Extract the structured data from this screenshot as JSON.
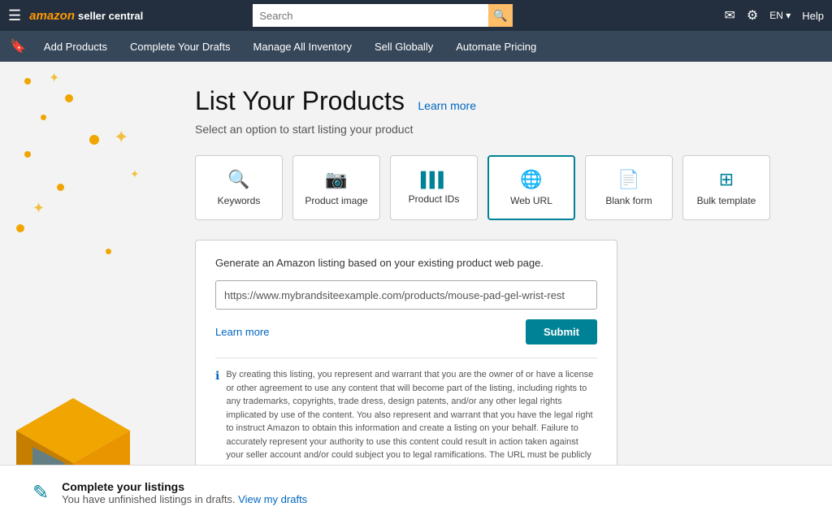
{
  "topbar": {
    "hamburger": "☰",
    "logo_amazon": "amazon",
    "logo_text": "seller central",
    "search_placeholder": "Search",
    "search_icon": "🔍",
    "mail_icon": "✉",
    "settings_icon": "⚙",
    "language": "EN ▾",
    "help": "Help"
  },
  "navbar": {
    "bookmark_icon": "🔖",
    "items": [
      {
        "label": "Add Products",
        "id": "add-products"
      },
      {
        "label": "Complete Your Drafts",
        "id": "complete-drafts"
      },
      {
        "label": "Manage All Inventory",
        "id": "manage-inventory"
      },
      {
        "label": "Sell Globally",
        "id": "sell-globally"
      },
      {
        "label": "Automate Pricing",
        "id": "automate-pricing"
      }
    ]
  },
  "page": {
    "title": "List Your Products",
    "learn_more": "Learn more",
    "subtitle": "Select an option to start listing your product"
  },
  "options": [
    {
      "id": "keywords",
      "icon": "🔍",
      "label": "Keywords"
    },
    {
      "id": "product-image",
      "icon": "📷",
      "label": "Product image"
    },
    {
      "id": "product-ids",
      "icon": "▌▌▌",
      "label": "Product IDs"
    },
    {
      "id": "web-url",
      "icon": "🌐",
      "label": "Web URL",
      "active": true
    },
    {
      "id": "blank-form",
      "icon": "📄",
      "label": "Blank form"
    },
    {
      "id": "bulk-template",
      "icon": "⊞",
      "label": "Bulk template"
    }
  ],
  "form": {
    "description": "Generate an Amazon listing based on your existing product web page.",
    "url_placeholder": "https://www.mybrandsiteexample.com/products/mouse-pad-gel-wrist-rest",
    "url_value": "https://www.mybrandsiteexample.com/products/mouse-pad-gel-wrist-rest",
    "learn_more": "Learn more",
    "submit_label": "Submit",
    "disclaimer": "By creating this listing, you represent and warrant that you are the owner of or have a license or other agreement to use any content that will become part of the listing, including rights to any trademarks, copyrights, trade dress, design patents, and/or any other legal rights implicated by use of the content. You also represent and warrant that you have the legal right to instruct Amazon to obtain this information and create a listing on your behalf. Failure to accurately represent your authority to use this content could result in action taken against your seller account and/or could subject you to legal ramifications. The URL must be publicly accessible and not be protected by credentials."
  },
  "bottom_banner": {
    "icon": "✎",
    "title": "Complete your listings",
    "subtitle": "You have unfinished listings in drafts.",
    "link_text": "View my drafts"
  }
}
